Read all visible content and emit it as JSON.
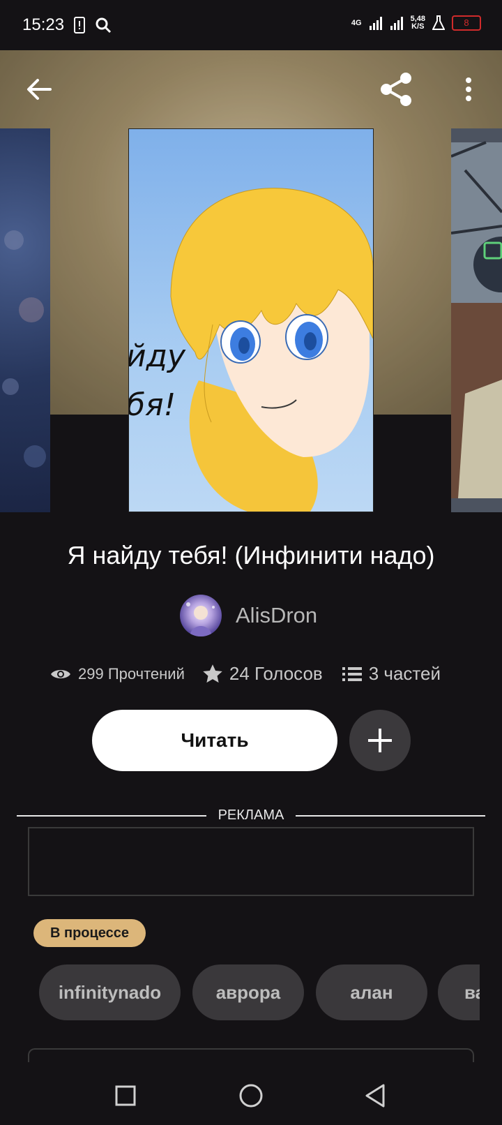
{
  "status_bar": {
    "time": "15:23",
    "network": "4G",
    "speed_value": "5,48",
    "speed_unit": "K/S",
    "battery": "8"
  },
  "story": {
    "title": "Я найду тебя! (Инфинити надо)",
    "cover_text_line1": "йду",
    "cover_text_line2": "бя!",
    "author": "AlisDron",
    "stats": {
      "reads": "299 Прочтений",
      "votes": "24 Голосов",
      "parts": "3 частей"
    },
    "read_button": "Читать",
    "status": "В процессе",
    "tags": [
      "infinitynado",
      "аврора",
      "алан",
      "ва"
    ]
  },
  "ads": {
    "label": "РЕКЛАМА"
  },
  "icons": {
    "back": "back-arrow-icon",
    "share": "share-icon",
    "more": "more-vert-icon",
    "eye": "eye-icon",
    "star": "star-icon",
    "list": "list-icon",
    "plus": "plus-icon"
  },
  "colors": {
    "background": "#141215",
    "badge": "#dcb67a",
    "tag_bg": "#3a383b",
    "battery_low": "#d12b2b"
  }
}
